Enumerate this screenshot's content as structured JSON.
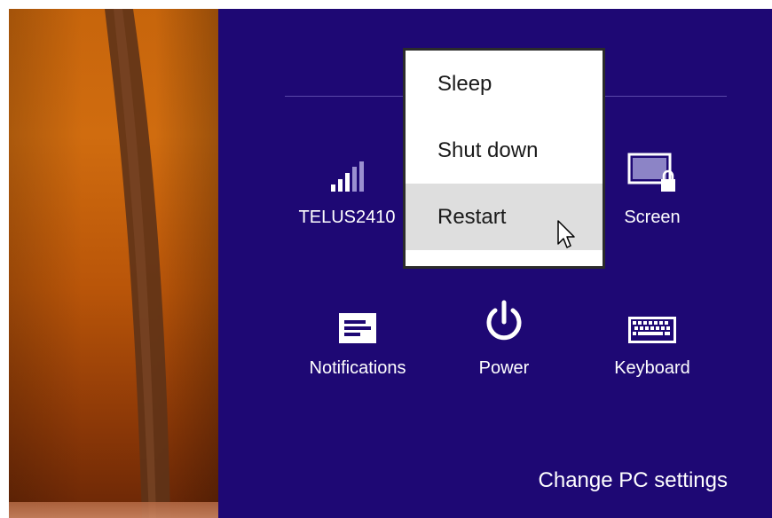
{
  "charms": {
    "network": {
      "label": "TELUS2410",
      "icon": "wifi-signal-icon"
    },
    "screen": {
      "label": "Screen",
      "icon": "screen-lock-icon"
    },
    "notifications": {
      "label": "Notifications",
      "icon": "notifications-icon"
    },
    "power": {
      "label": "Power",
      "icon": "power-icon"
    },
    "keyboard": {
      "label": "Keyboard",
      "icon": "keyboard-icon"
    }
  },
  "power_menu": {
    "items": [
      {
        "label": "Sleep"
      },
      {
        "label": "Shut down"
      },
      {
        "label": "Restart",
        "hovered": true
      }
    ]
  },
  "footer": {
    "change_settings": "Change PC settings"
  },
  "colors": {
    "charm_bg": "#1e0874",
    "menu_hover": "#dedede",
    "wallpaper": "#c7650c"
  }
}
